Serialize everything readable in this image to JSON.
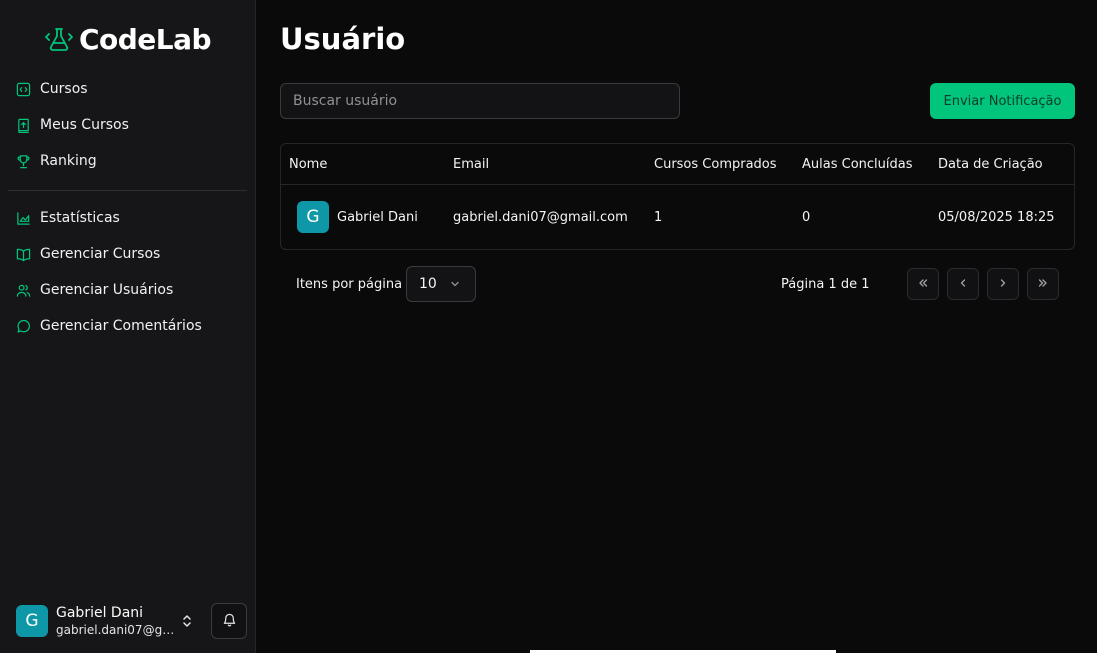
{
  "app": {
    "name": "CodeLab"
  },
  "sidebar": {
    "primary": [
      {
        "label": "Cursos",
        "icon": "code-square-icon"
      },
      {
        "label": "Meus Cursos",
        "icon": "book-upload-icon"
      },
      {
        "label": "Ranking",
        "icon": "trophy-icon"
      }
    ],
    "admin": [
      {
        "label": "Estatísticas",
        "icon": "chart-area-icon"
      },
      {
        "label": "Gerenciar Cursos",
        "icon": "book-open-icon"
      },
      {
        "label": "Gerenciar Usuários",
        "icon": "users-icon"
      },
      {
        "label": "Gerenciar Comentários",
        "icon": "message-circle-icon"
      }
    ],
    "user": {
      "initial": "G",
      "name": "Gabriel Dani",
      "email": "gabriel.dani07@gm..."
    }
  },
  "page": {
    "title": "Usuário",
    "search_placeholder": "Buscar usuário",
    "notify_button": "Enviar Notificação"
  },
  "table": {
    "headers": [
      "Nome",
      "Email",
      "Cursos Comprados",
      "Aulas Concluídas",
      "Data de Criação"
    ],
    "rows": [
      {
        "initial": "G",
        "name": "Gabriel Dani",
        "email": "gabriel.dani07@gmail.com",
        "courses": "1",
        "lessons": "0",
        "created": "05/08/2025 18:25"
      }
    ]
  },
  "pagination": {
    "per_page_label": "Itens por página",
    "per_page_value": "10",
    "page_info": "Página 1 de 1"
  },
  "colors": {
    "accent": "#00c57a",
    "avatar": "#0e97a6",
    "background": "#0a0a0b",
    "sidebar": "#161618"
  }
}
